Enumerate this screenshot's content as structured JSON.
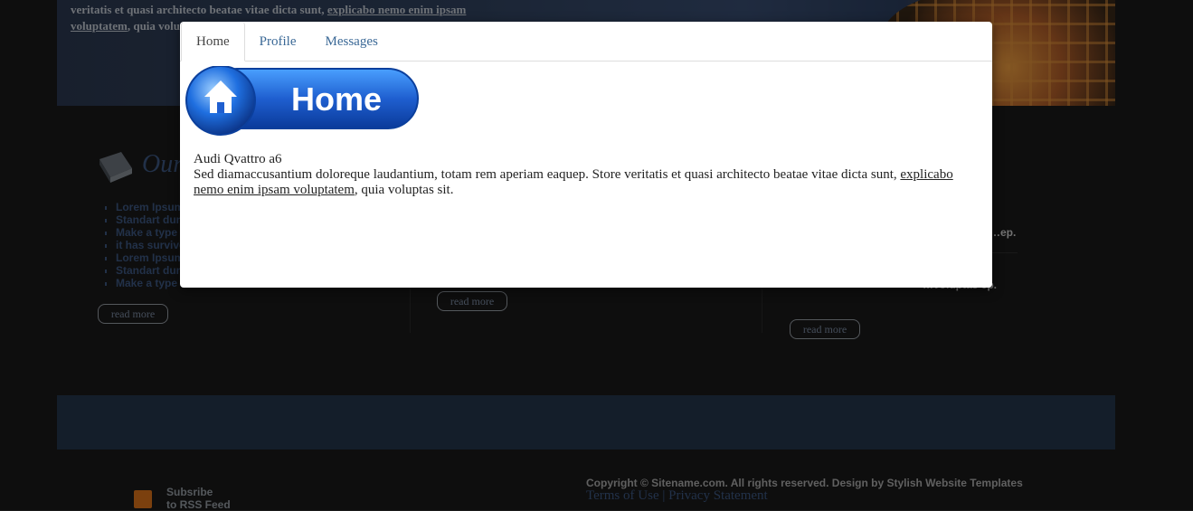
{
  "background": {
    "header_text": "veritatis et quasi architecto beatae vitae dicta sunt,",
    "header_link": "explicabo nemo enim ipsam voluptatem",
    "header_text_tail": ", quia voluptas sit.",
    "section_title": "Our",
    "list_items": [
      "Lorem Ipsum",
      "Standart dummy",
      "Make a type",
      "it has survived",
      "Lorem Ipsum",
      "Standart dummy",
      "Make a type"
    ],
    "read_more_label": "read more",
    "right_text_1": "…ep.",
    "right_text_2": "…voluptas ep.",
    "rss_label_line1": "Subsribe",
    "rss_label_line2": "to RSS Feed",
    "copyright": "Copyright © Sitename.com. All rights reserved. Design by Stylish Website Templates",
    "terms_link": "Terms of Use",
    "links_separator": "|",
    "privacy_link": "Privacy Statement"
  },
  "modal": {
    "tabs": [
      {
        "label": "Home",
        "active": true
      },
      {
        "label": "Profile",
        "active": false
      },
      {
        "label": "Messages",
        "active": false
      }
    ],
    "banner_text": "Home",
    "content": {
      "title": "Audi Qvattro a6",
      "body": "Sed diamaccusantium doloreque laudantium, totam rem aperiam eaquep. Store veritatis et quasi architecto beatae vitae dicta sunt,",
      "link": "explicabo nemo enim ipsam voluptatem",
      "tail": ", quia voluptas sit."
    }
  },
  "colors": {
    "accent": "#3a6896",
    "banner_blue": "#1f5fd0",
    "overlay": "#000000"
  }
}
